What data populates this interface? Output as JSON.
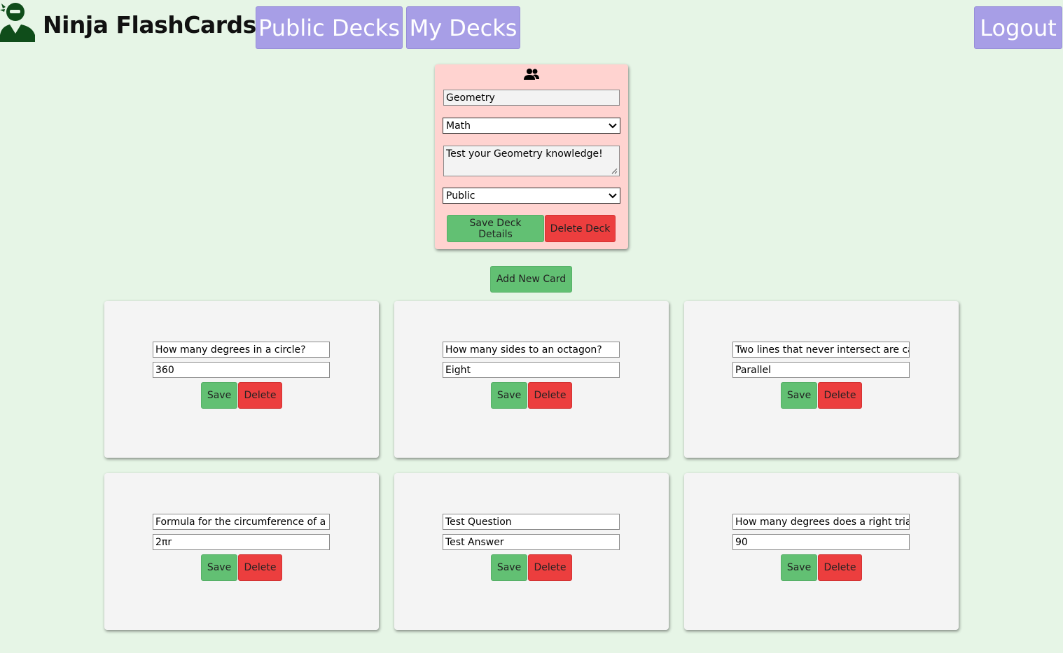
{
  "header": {
    "app_title": "Ninja FlashCards",
    "nav": {
      "public_decks": "Public Decks",
      "my_decks": "My Decks",
      "logout": "Logout"
    },
    "accent_color": "#a79ee6"
  },
  "deck": {
    "icon": "people-icon",
    "name": "Geometry",
    "category": "Math",
    "description": "Test your Geometry knowledge!",
    "visibility": "Public",
    "save_label": "Save Deck Details",
    "delete_label": "Delete Deck",
    "panel_color": "#ffd3d0"
  },
  "add_card_label": "Add New Card",
  "cards": [
    {
      "question": "How many degrees in a circle?",
      "answer": "360",
      "save": "Save",
      "delete": "Delete"
    },
    {
      "question": "How many sides to an octagon?",
      "answer": "Eight",
      "save": "Save",
      "delete": "Delete"
    },
    {
      "question": "Two lines that never intersect are called",
      "answer": "Parallel",
      "save": "Save",
      "delete": "Delete"
    },
    {
      "question": "Formula for the circumference of a circle",
      "answer": "2πr",
      "save": "Save",
      "delete": "Delete"
    },
    {
      "question": "Test Question",
      "answer": "Test Answer",
      "save": "Save",
      "delete": "Delete"
    },
    {
      "question": "How many degrees does a right triangle have",
      "answer": "90",
      "save": "Save",
      "delete": "Delete"
    }
  ],
  "colors": {
    "background": "#e6f5e6",
    "save_green": "#62c073",
    "delete_red": "#ec3e3e",
    "logo_green": "#0f4d1a"
  }
}
